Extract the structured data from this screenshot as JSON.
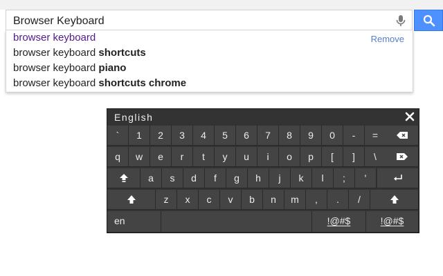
{
  "search": {
    "value": "Browser Keyboard",
    "button_icon": "search-icon",
    "mic_icon": "microphone-icon"
  },
  "suggestions": {
    "items": [
      {
        "prefix": "browser keyboard",
        "bold": "",
        "history": true
      },
      {
        "prefix": "browser keyboard ",
        "bold": "shortcuts",
        "history": false
      },
      {
        "prefix": "browser keyboard ",
        "bold": "piano",
        "history": false
      },
      {
        "prefix": "browser keyboard ",
        "bold": "shortcuts chrome",
        "history": false
      }
    ],
    "remove_label": "Remove"
  },
  "keyboard": {
    "language": "English",
    "close_icon": "close-icon",
    "row1": [
      "`",
      "1",
      "2",
      "3",
      "4",
      "5",
      "6",
      "7",
      "8",
      "9",
      "0",
      "-",
      "="
    ],
    "row2": [
      "q",
      "w",
      "e",
      "r",
      "t",
      "y",
      "u",
      "i",
      "o",
      "p",
      "[",
      "]",
      "\\"
    ],
    "row3": [
      "a",
      "s",
      "d",
      "f",
      "g",
      "h",
      "j",
      "k",
      "l",
      ";",
      "'"
    ],
    "row4": [
      "z",
      "x",
      "c",
      "v",
      "b",
      "n",
      "m",
      ",",
      ".",
      "/"
    ],
    "lang_key": "en",
    "space_label": "",
    "sym_left": "!@#$",
    "sym_right": "!@#$",
    "icons": {
      "backspace": "backspace-icon",
      "tab": "tab-icon",
      "capslock": "caps-lock-icon",
      "enter": "enter-icon",
      "shift_left": "shift-icon",
      "shift_right": "shift-icon"
    }
  },
  "colors": {
    "accent": "#4d90fe",
    "keyboard_bg": "#333333",
    "key_bg": "#444444",
    "history_text": "#52188c",
    "remove_link": "#5880c3"
  }
}
